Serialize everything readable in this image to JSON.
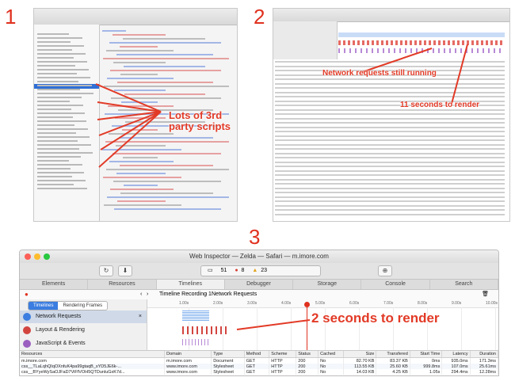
{
  "labels": {
    "one": "1",
    "two": "2",
    "three": "3"
  },
  "annotations": {
    "third_party": "Lots of 3rd\nparty scripts",
    "network_running": "Network requests still running",
    "render_11s": "11 seconds to render",
    "render_2s": "2 seconds to render"
  },
  "inspector": {
    "title": "Web Inspector — Zelda — Safari — m.imore.com",
    "activity": {
      "resources": "51",
      "errors": "8",
      "warnings": "23"
    },
    "tabs": [
      "Elements",
      "Resources",
      "Timelines",
      "Debugger",
      "Storage",
      "Console",
      "Search"
    ],
    "active_tab": "Timelines",
    "breadcrumb": [
      "Timeline Recording 1",
      "Network Requests"
    ],
    "segmented": [
      "Timelines",
      "Rendering Frames"
    ],
    "timelines": [
      "Network Requests",
      "Layout & Rendering",
      "JavaScript & Events"
    ],
    "ruler": [
      "1.00s",
      "2.00s",
      "3.00s",
      "4.00s",
      "5.00s",
      "6.00s",
      "7.00s",
      "8.00s",
      "9.00s",
      "10.00s"
    ],
    "table": {
      "headers": [
        "Resources",
        "Domain",
        "Type",
        "Method",
        "Scheme",
        "Status",
        "Cached",
        "Size",
        "Transfered",
        "Start Time",
        "Latency",
        "Duration"
      ],
      "rows": [
        [
          "m.imore.com",
          "m.imore.com",
          "Document",
          "GET",
          "HTTP",
          "200",
          "No",
          "82.70 KB",
          "83.37 KB",
          "0ms",
          "935.0ms",
          "171.3ms"
        ],
        [
          "css__TLaLqhQIqOXnfuK4pa99gtaqB_sYD5JE6k-...",
          "www.imore.com",
          "Stylesheet",
          "GET",
          "HTTP",
          "200",
          "No",
          "113.55 KB",
          "25.60 KB",
          "999.8ms",
          "107.0ms",
          "25.61ms"
        ],
        [
          "css__BYyeWySaOJFaD7ViFfVOH5QTDunluGxK7d...",
          "www.imore.com",
          "Stylesheet",
          "GET",
          "HTTP",
          "200",
          "No",
          "14.03 KB",
          "4.25 KB",
          "1.05s",
          "294.4ms",
          "12.28ms"
        ]
      ]
    }
  },
  "colors": {
    "accent": "#e23a26",
    "network": "#3b7de0",
    "layout": "#d2453f",
    "script": "#9b5fc0"
  }
}
